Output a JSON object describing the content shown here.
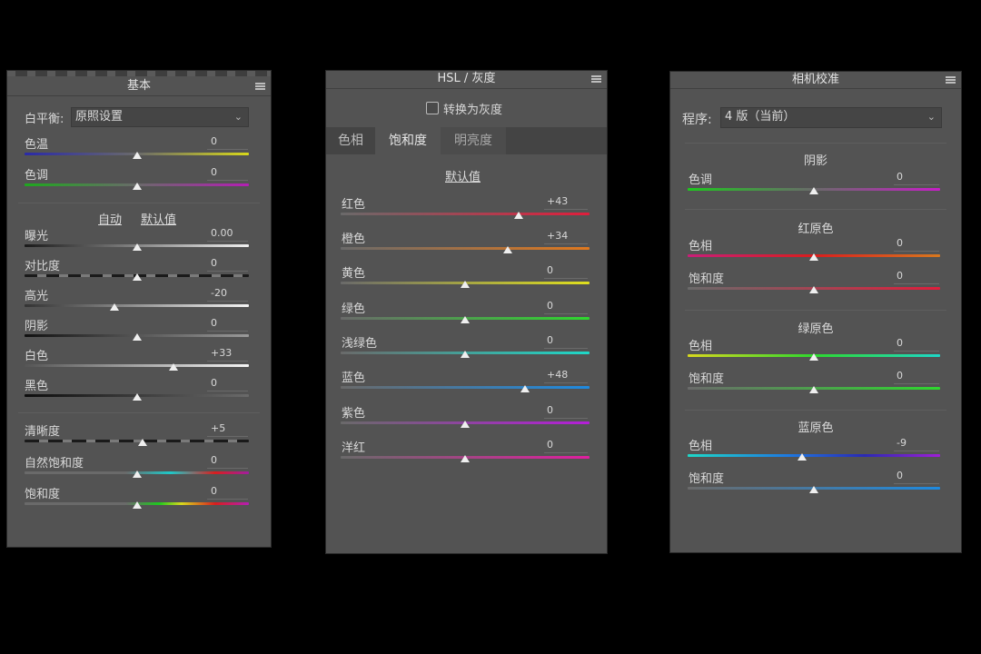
{
  "basic": {
    "title": "基本",
    "wb_label": "白平衡:",
    "wb_value": "原照设置",
    "auto_label": "自动",
    "default_label": "默认值",
    "sliders": [
      {
        "label": "色温",
        "value": "0",
        "pos": 0.5
      },
      {
        "label": "色调",
        "value": "0",
        "pos": 0.5
      },
      {
        "label": "曝光",
        "value": "0.00",
        "pos": 0.5
      },
      {
        "label": "对比度",
        "value": "0",
        "pos": 0.5
      },
      {
        "label": "高光",
        "value": "-20",
        "pos": 0.4
      },
      {
        "label": "阴影",
        "value": "0",
        "pos": 0.5
      },
      {
        "label": "白色",
        "value": "+33",
        "pos": 0.665
      },
      {
        "label": "黑色",
        "value": "0",
        "pos": 0.5
      },
      {
        "label": "清晰度",
        "value": "+5",
        "pos": 0.525
      },
      {
        "label": "自然饱和度",
        "value": "0",
        "pos": 0.5
      },
      {
        "label": "饱和度",
        "value": "0",
        "pos": 0.5
      }
    ]
  },
  "hsl": {
    "title": "HSL / 灰度",
    "convert_label": "转换为灰度",
    "tabs": [
      "色相",
      "饱和度",
      "明亮度"
    ],
    "active_tab": "饱和度",
    "default_label": "默认值",
    "sliders": [
      {
        "label": "红色",
        "value": "+43",
        "pos": 0.715
      },
      {
        "label": "橙色",
        "value": "+34",
        "pos": 0.67
      },
      {
        "label": "黄色",
        "value": "0",
        "pos": 0.5
      },
      {
        "label": "绿色",
        "value": "0",
        "pos": 0.5
      },
      {
        "label": "浅绿色",
        "value": "0",
        "pos": 0.5
      },
      {
        "label": "蓝色",
        "value": "+48",
        "pos": 0.74
      },
      {
        "label": "紫色",
        "value": "0",
        "pos": 0.5
      },
      {
        "label": "洋红",
        "value": "0",
        "pos": 0.5
      }
    ]
  },
  "calibration": {
    "title": "相机校准",
    "process_label": "程序:",
    "process_value": "4 版（当前）",
    "shadows_title": "阴影",
    "shadow_tint_label": "色调",
    "shadow_tint_value": "0",
    "red_title": "红原色",
    "green_title": "绿原色",
    "blue_title": "蓝原色",
    "hue_label": "色相",
    "sat_label": "饱和度",
    "red_hue_value": "0",
    "red_sat_value": "0",
    "green_hue_value": "0",
    "green_sat_value": "0",
    "blue_hue_value": "-9",
    "blue_sat_value": "0",
    "blue_hue_pos": 0.455
  }
}
